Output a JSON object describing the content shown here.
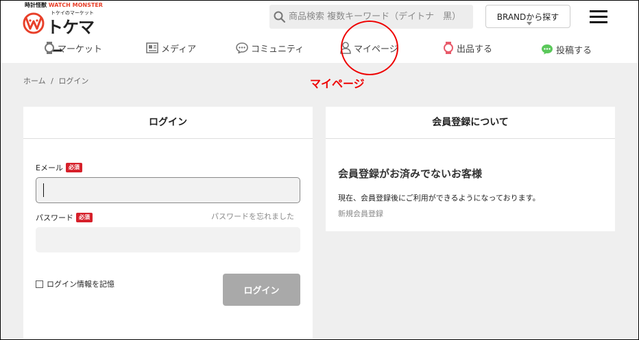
{
  "header": {
    "logo": {
      "tagline_jp": "時計怪獣",
      "tagline_en": "WATCH MONSTER",
      "subtitle": "トケイのマーケット",
      "name": "トケマー"
    },
    "search": {
      "placeholder": "商品検索 複数キーワード（デイトナ　黒）"
    },
    "brand_button": "BRANDから探す",
    "menu_icon": "hamburger-icon"
  },
  "nav": {
    "items": [
      {
        "label": "マーケット",
        "icon": "watch-icon"
      },
      {
        "label": "メディア",
        "icon": "newspaper-icon"
      },
      {
        "label": "コミュニティ",
        "icon": "chat-icon"
      },
      {
        "label": "マイページ",
        "icon": "user-icon"
      },
      {
        "label": "出品する",
        "icon": "watch-icon"
      },
      {
        "label": "投稿する",
        "icon": "chat-icon"
      }
    ]
  },
  "annotation": {
    "label": "マイページ",
    "color": "#e00000"
  },
  "breadcrumb": {
    "home": "ホーム",
    "separator": "/",
    "current": "ログイン"
  },
  "login": {
    "title": "ログイン",
    "email_label": "Eメール",
    "required_badge": "必須",
    "email_value": "",
    "password_label": "パスワード",
    "password_value": "",
    "forgot_link": "パスワードを忘れました",
    "remember_label": "ログイン情報を記憶",
    "submit": "ログイン"
  },
  "registration": {
    "title": "会員登録について",
    "heading": "会員登録がお済みでないお客様",
    "description": "現在、会員登録後にご利用ができるようになっております。",
    "link": "新規会員登録"
  },
  "colors": {
    "accent_red": "#d6202a",
    "logo_red": "#e8402a",
    "nav_pink": "#e85a6a",
    "nav_green": "#5ac85a",
    "button_gray": "#a9a9a9"
  }
}
